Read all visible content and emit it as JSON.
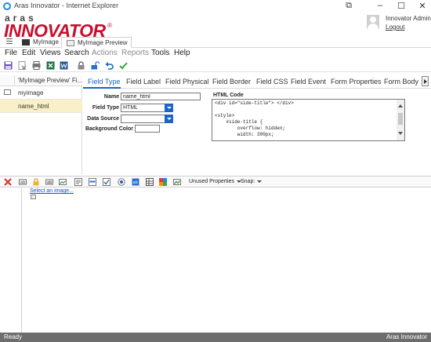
{
  "window": {
    "title": "Aras Innovator - Internet Explorer",
    "controls": [
      "⧉",
      "–",
      "☐",
      "✕"
    ]
  },
  "brand": {
    "logo_top": "aras",
    "logo_main": "INNOVATOR",
    "logo_reg": "®",
    "user_name": "Innovator Admin",
    "logout": "Logout"
  },
  "tabs": [
    {
      "label": "MyImage",
      "active": false
    },
    {
      "label": "MyImage Preview",
      "active": true
    }
  ],
  "menu": [
    {
      "label": "File",
      "disabled": false
    },
    {
      "label": "Edit",
      "disabled": false
    },
    {
      "label": "Views",
      "disabled": false
    },
    {
      "label": "Search",
      "disabled": false
    },
    {
      "label": "Actions",
      "disabled": true
    },
    {
      "label": "Reports",
      "disabled": true
    },
    {
      "label": "Tools",
      "disabled": false
    },
    {
      "label": "Help",
      "disabled": false
    }
  ],
  "toolbar_icons": [
    "save-icon",
    "delete-icon",
    "print-icon",
    "excel-icon",
    "word-icon",
    "lock-icon",
    "unlock-icon",
    "undo-icon",
    "done-icon"
  ],
  "left_panel": {
    "header": "'MyImage Preview' Fi...",
    "rows": [
      {
        "label": "myimage",
        "selected": false
      },
      {
        "label": "name_html",
        "selected": true
      }
    ]
  },
  "panel_tabs": [
    "Field Type",
    "Field Label",
    "Field Physical",
    "Field Border",
    "Field CSS",
    "Field Event",
    "Form Properties",
    "Form Body"
  ],
  "form": {
    "name_label": "Name",
    "name_value": "name_html",
    "field_type_label": "Field Type",
    "field_type_value": "HTML",
    "data_source_label": "Data Source",
    "data_source_value": "",
    "bg_color_label": "Background Color",
    "bg_color_value": "",
    "html_code_label": "HTML Code",
    "html_code": "<div id=\"side-title\"> </div>\n\n<style>\n    #side-title {\n        overflow: hidden;\n        width: 300px;"
  },
  "bottom_toolbar": {
    "icons": [
      "delete-field-icon",
      "text-field-icon",
      "lock-field-icon",
      "label-field-icon",
      "image-field-icon",
      "textarea-field-icon",
      "list-field-icon",
      "checkbox-field-icon",
      "radio-field-icon",
      "html-field-icon",
      "grid-field-icon",
      "palette-field-icon",
      "picture-field-icon"
    ],
    "unused_properties": "Unused Properties",
    "snap": "Snap:"
  },
  "canvas": {
    "select_image": "Select an image..."
  },
  "status": {
    "left": "Ready",
    "right": "Aras Innovator"
  },
  "colors": {
    "brand_red": "#c8102e",
    "accent_blue": "#1565c0",
    "selected_row": "#faf0c8",
    "statusbar": "#6d6d6d"
  }
}
